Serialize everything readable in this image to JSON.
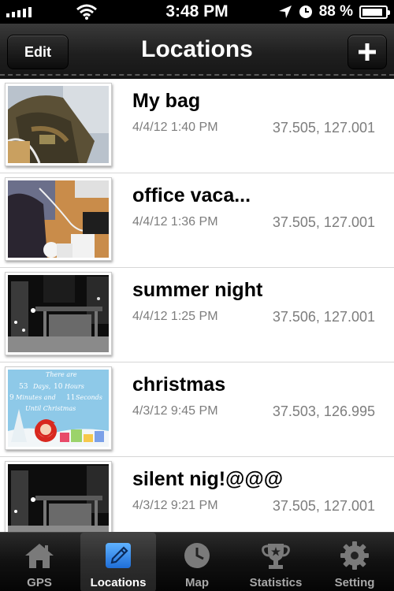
{
  "status_bar": {
    "time": "3:48 PM",
    "battery_text": "88 %",
    "battery_level": 0.88,
    "icons": [
      "signal-icon",
      "wifi-icon",
      "location-arrow-icon",
      "alarm-clock-icon",
      "battery-icon"
    ]
  },
  "nav": {
    "title": "Locations",
    "edit_label": "Edit",
    "add_icon": "plus-icon"
  },
  "locations": [
    {
      "name": "My bag",
      "date": "4/4/12 1:40 PM",
      "coords": "37.505, 127.001"
    },
    {
      "name": "office vaca...",
      "date": "4/4/12 1:36 PM",
      "coords": "37.505, 127.001"
    },
    {
      "name": "summer night",
      "date": "4/4/12 1:25 PM",
      "coords": "37.506, 127.001"
    },
    {
      "name": "christmas",
      "date": "4/3/12 9:45 PM",
      "coords": "37.503, 126.995"
    },
    {
      "name": "silent nig!@@@",
      "date": "4/3/12 9:21 PM",
      "coords": "37.505, 127.001"
    }
  ],
  "christmas_photo_text": [
    "There are",
    "53",
    "Days,",
    "10",
    "Hours",
    "9",
    "Minutes and",
    "11",
    "Seconds",
    "Until Christmas"
  ],
  "tabs": [
    {
      "label": "GPS",
      "icon": "house-icon",
      "active": false
    },
    {
      "label": "Locations",
      "icon": "pencil-note-icon",
      "active": true
    },
    {
      "label": "Map",
      "icon": "clock-pin-icon",
      "active": false
    },
    {
      "label": "Statistics",
      "icon": "trophy-icon",
      "active": false
    },
    {
      "label": "Setting",
      "icon": "gear-icon",
      "active": false
    }
  ],
  "colors": {
    "accent_blue": "#2f86e3",
    "secondary_text": "#7d7d7d",
    "bar_dark": "#1f1f1f"
  }
}
